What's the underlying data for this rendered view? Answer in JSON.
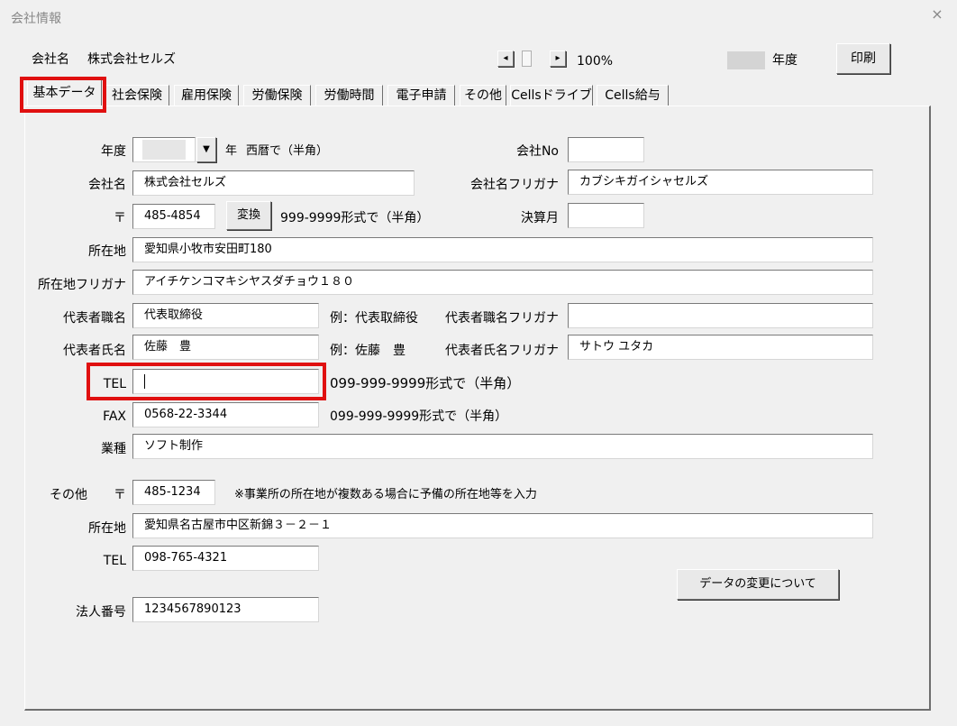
{
  "window": {
    "title": "会社情報",
    "close_glyph": "×"
  },
  "header": {
    "company_label": "会社名",
    "company_name": "株式会社セルズ",
    "zoom": "100%",
    "year_label": "年度",
    "print_button": "印刷",
    "zoom_left_glyph": "◂",
    "zoom_right_glyph": "▸"
  },
  "tabs": [
    "基本データ",
    "社会保険",
    "雇用保険",
    "労働保険",
    "労働時間",
    "電子申請",
    "その他",
    "Cellsドライブ",
    "Cells給与"
  ],
  "form": {
    "year_label": "年度",
    "year_suffix": "年",
    "year_hint": "西暦で（半角）",
    "company_no_label": "会社No",
    "company_name_label": "会社名",
    "company_name_value": "株式会社セルズ",
    "company_kana_label": "会社名フリガナ",
    "company_kana_value": "カブシキガイシャセルズ",
    "zip_label": "〒",
    "zip_value": "485-4854",
    "convert_button": "変換",
    "zip_hint": "999-9999形式で（半角）",
    "fiscal_month_label": "決算月",
    "address_label": "所在地",
    "address_value": "愛知県小牧市安田町180",
    "address_kana_label": "所在地フリガナ",
    "address_kana_value": "アイチケンコマキシヤスダチョウ１８０",
    "rep_title_label": "代表者職名",
    "rep_title_value": "代表取締役",
    "rep_title_example": "例：代表取締役",
    "rep_title_kana_label": "代表者職名フリガナ",
    "rep_name_label": "代表者氏名",
    "rep_name_value": "佐藤　豊",
    "rep_name_example": "例：佐藤　豊",
    "rep_name_kana_label": "代表者氏名フリガナ",
    "rep_name_kana_value": "サトウ ユタカ",
    "tel_label": "TEL",
    "tel_value": "",
    "tel_hint": "099-999-9999形式で（半角）",
    "fax_label": "FAX",
    "fax_value": "0568-22-3344",
    "fax_hint": "099-999-9999形式で（半角）",
    "industry_label": "業種",
    "industry_value": "ソフト制作",
    "other_label": "その他",
    "other_zip_label": "〒",
    "other_zip_value": "485-1234",
    "other_note": "※事業所の所在地が複数ある場合に予備の所在地等を入力",
    "other_address_label": "所在地",
    "other_address_value": "愛知県名古屋市中区新錦３－２－１",
    "other_tel_label": "TEL",
    "other_tel_value": "098-765-4321",
    "about_changes_button": "データの変更について",
    "corp_number_label": "法人番号",
    "corp_number_value": "1234567890123",
    "dropdown_glyph": "▼"
  },
  "colors": {
    "highlight": "#e01010",
    "background": "#f0f0f0"
  }
}
